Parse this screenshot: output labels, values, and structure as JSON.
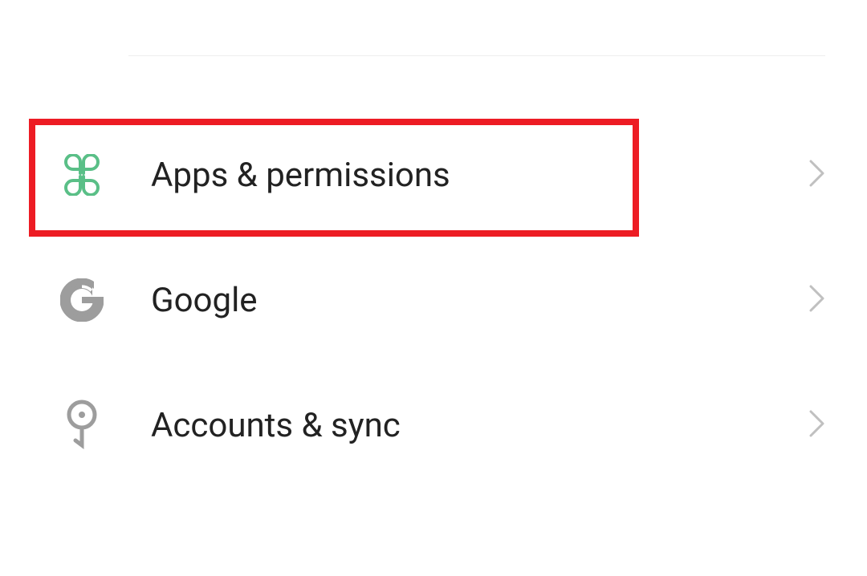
{
  "settings": {
    "items": [
      {
        "label": "Apps & permissions"
      },
      {
        "label": "Google"
      },
      {
        "label": "Accounts & sync"
      }
    ]
  },
  "colors": {
    "highlight": "#ed1c24",
    "apps_icon": "#5abf87",
    "neutral_icon": "#9d9d9d",
    "chevron": "#c0c0c0"
  }
}
